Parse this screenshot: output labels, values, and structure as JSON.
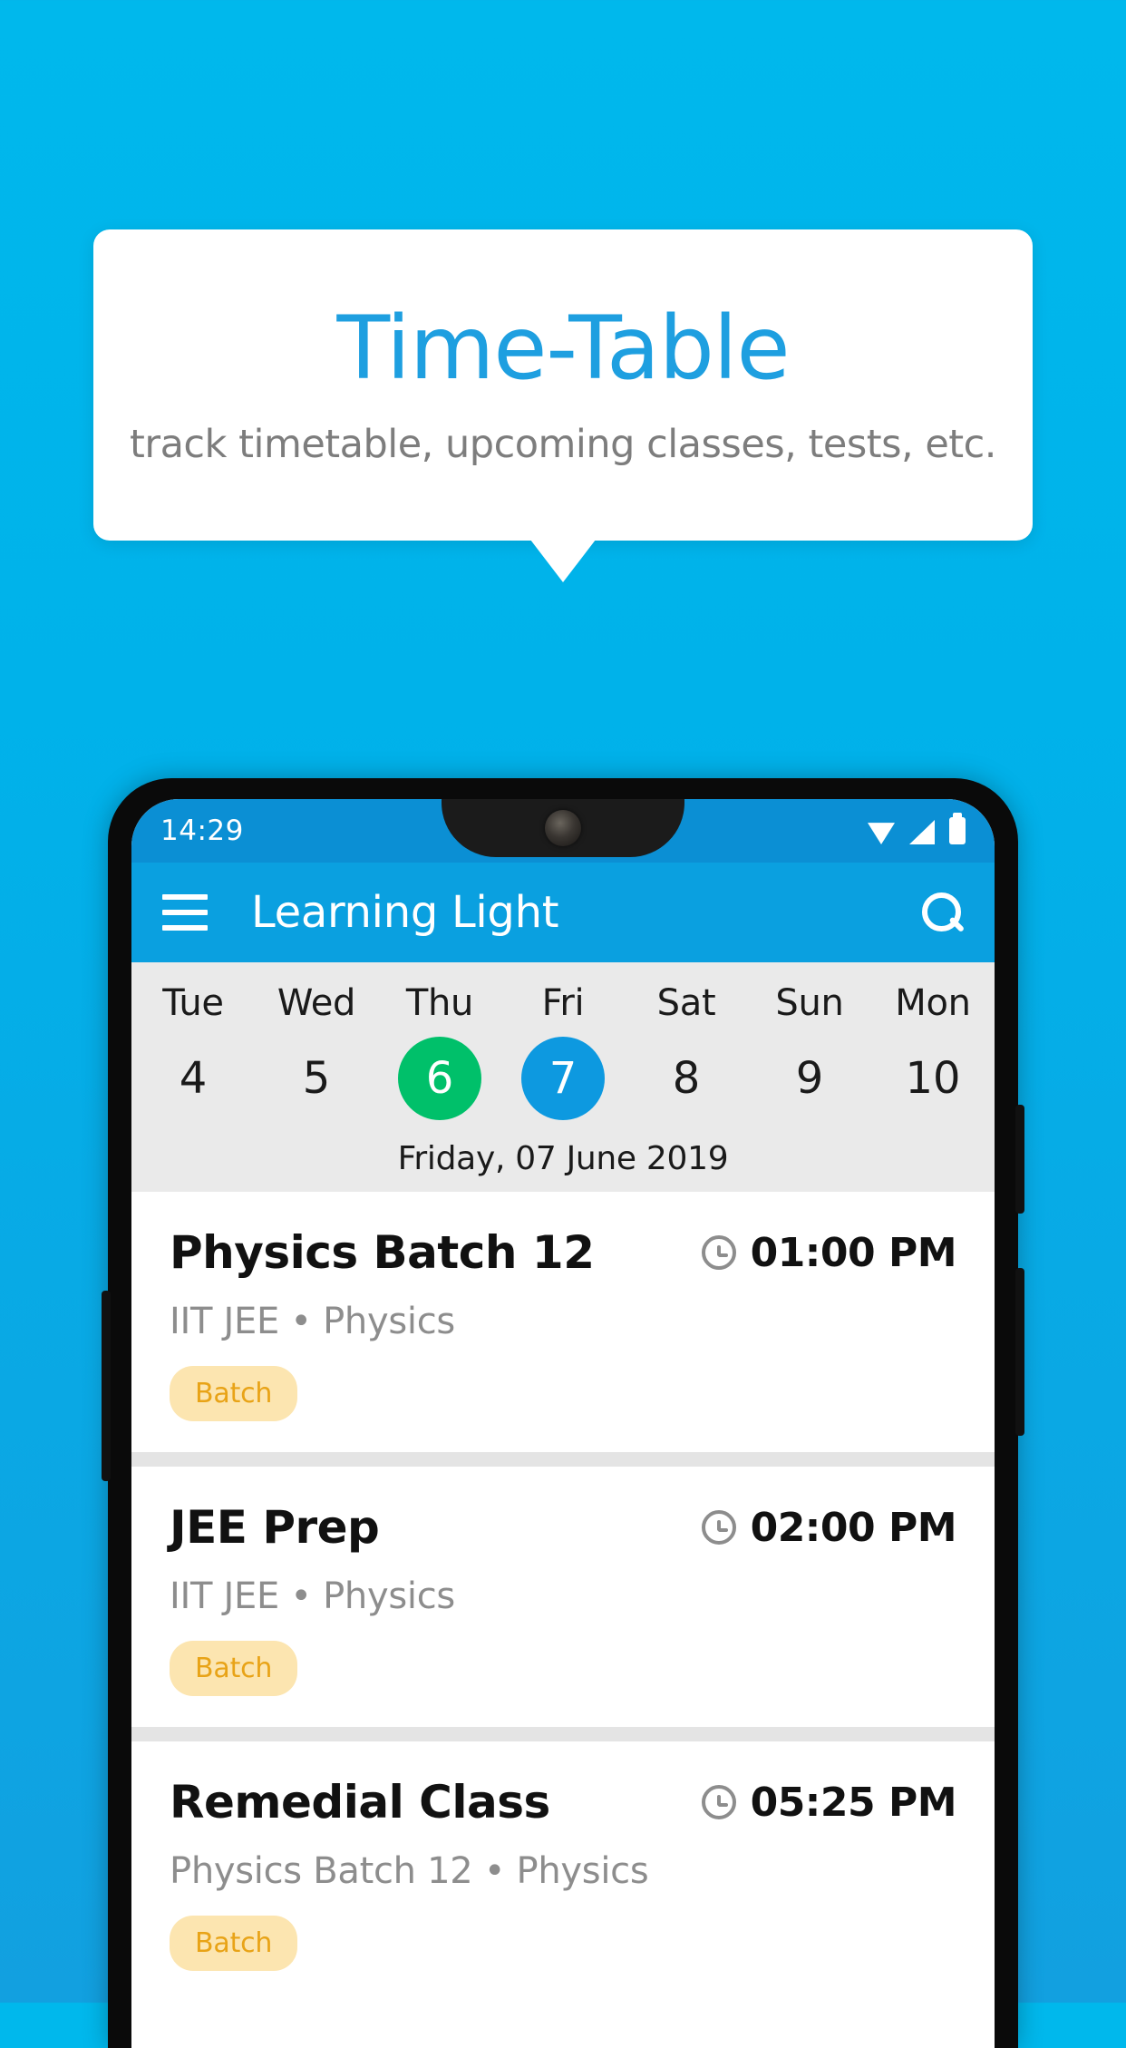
{
  "promo": {
    "title": "Time-Table",
    "subtitle": "track timetable, upcoming classes, tests, etc.",
    "title_color": "#1e9fe0",
    "background_color": "#00b2ea"
  },
  "phone": {
    "statusbar": {
      "time": "14:29",
      "icons": [
        "wifi-icon",
        "signal-icon",
        "battery-icon"
      ]
    },
    "appbar": {
      "menu_icon": "hamburger-menu-icon",
      "title": "Learning Light",
      "search_icon": "search-icon",
      "background_color": "#0aa0e0"
    },
    "calendar": {
      "days": [
        {
          "dow": "Tue",
          "num": "4",
          "state": "normal"
        },
        {
          "dow": "Wed",
          "num": "5",
          "state": "normal"
        },
        {
          "dow": "Thu",
          "num": "6",
          "state": "today"
        },
        {
          "dow": "Fri",
          "num": "7",
          "state": "selected"
        },
        {
          "dow": "Sat",
          "num": "8",
          "state": "normal"
        },
        {
          "dow": "Sun",
          "num": "9",
          "state": "normal"
        },
        {
          "dow": "Mon",
          "num": "10",
          "state": "normal"
        }
      ],
      "today_color": "#00c06a",
      "selected_color": "#0d99e0",
      "date_label": "Friday, 07 June 2019"
    },
    "classes": [
      {
        "title": "Physics Batch 12",
        "time": "01:00 PM",
        "subtitle": "IIT JEE • Physics",
        "badge": "Batch"
      },
      {
        "title": "JEE Prep",
        "time": "02:00 PM",
        "subtitle": "IIT JEE • Physics",
        "badge": "Batch"
      },
      {
        "title": "Remedial Class",
        "time": "05:25 PM",
        "subtitle": "Physics Batch 12 • Physics",
        "badge": "Batch"
      }
    ],
    "badge_colors": {
      "background": "#fce5b0",
      "text": "#e8a317"
    }
  }
}
